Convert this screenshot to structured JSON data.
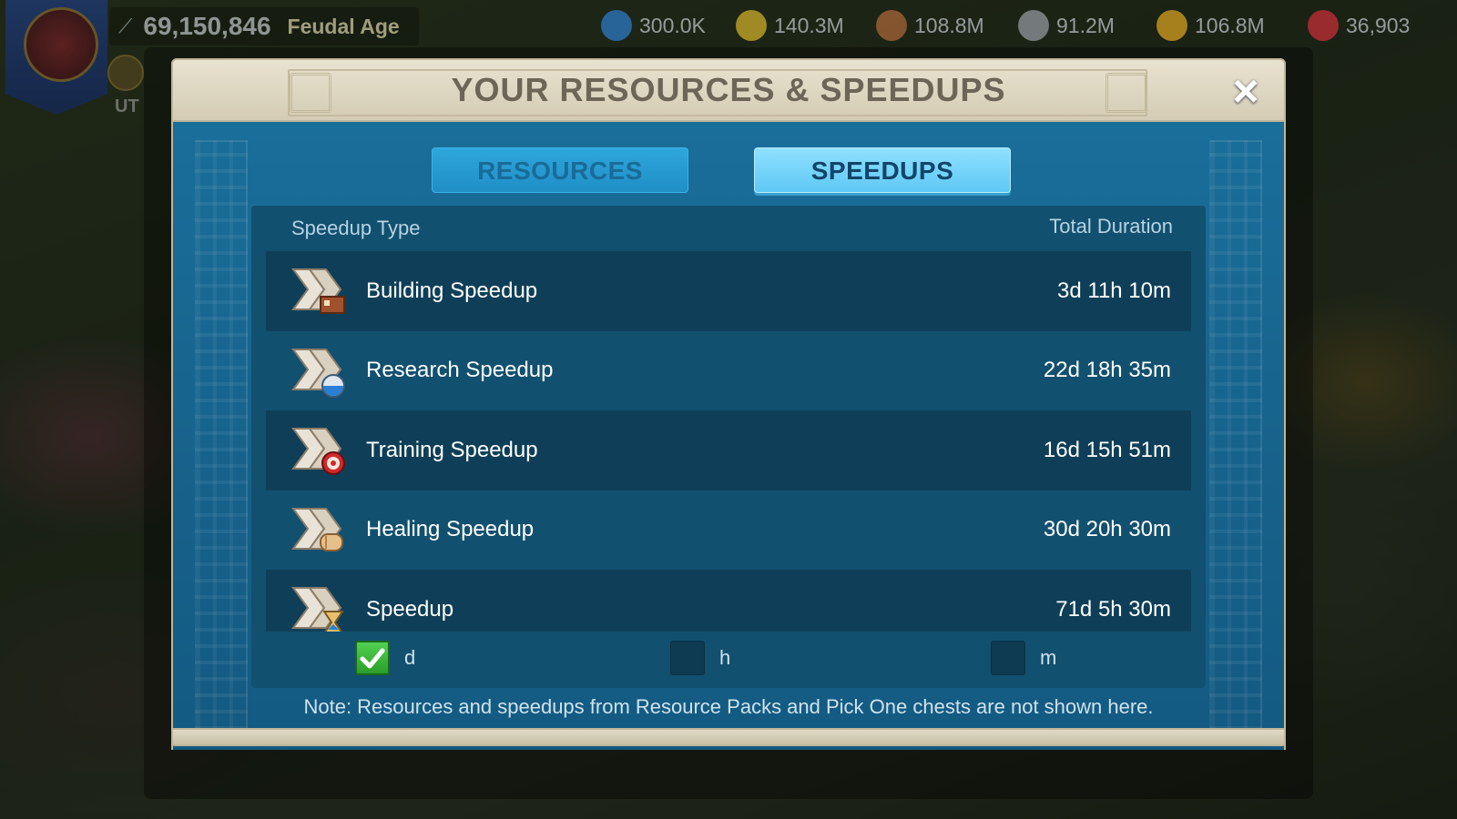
{
  "hud": {
    "power": "69,150,846",
    "age": "Feudal Age",
    "vip_label": "UT",
    "resources": [
      {
        "name": "gems-blue",
        "value": "300.0K",
        "color": "#2f7fd0"
      },
      {
        "name": "food",
        "value": "140.3M",
        "color": "#d8b62a"
      },
      {
        "name": "wood",
        "value": "108.8M",
        "color": "#b06a3a"
      },
      {
        "name": "stone",
        "value": "91.2M",
        "color": "#9aa0a6"
      },
      {
        "name": "gold",
        "value": "106.8M",
        "color": "#e0a820"
      },
      {
        "name": "gems",
        "value": "36,903",
        "color": "#d0303a"
      }
    ]
  },
  "modal": {
    "title": "YOUR RESOURCES & SPEEDUPS",
    "close_icon": "×",
    "tabs": [
      {
        "label": "RESOURCES",
        "active": false
      },
      {
        "label": "SPEEDUPS",
        "active": true
      }
    ],
    "table": {
      "col_type": "Speedup Type",
      "col_duration": "Total Duration",
      "rows": [
        {
          "name": "Building Speedup",
          "duration": "3d 11h 10m",
          "icon": "building-speedup-icon"
        },
        {
          "name": "Research Speedup",
          "duration": "22d 18h 35m",
          "icon": "research-speedup-icon"
        },
        {
          "name": "Training Speedup",
          "duration": "16d 15h 51m",
          "icon": "training-speedup-icon"
        },
        {
          "name": "Healing Speedup",
          "duration": "30d 20h 30m",
          "icon": "healing-speedup-icon"
        },
        {
          "name": "Speedup",
          "duration": "71d 5h 30m",
          "icon": "universal-speedup-icon"
        }
      ]
    },
    "units": [
      {
        "label": "d",
        "checked": true
      },
      {
        "label": "h",
        "checked": false
      },
      {
        "label": "m",
        "checked": false
      }
    ],
    "note": "Note: Resources and speedups from Resource Packs and Pick One chests are not shown here."
  }
}
